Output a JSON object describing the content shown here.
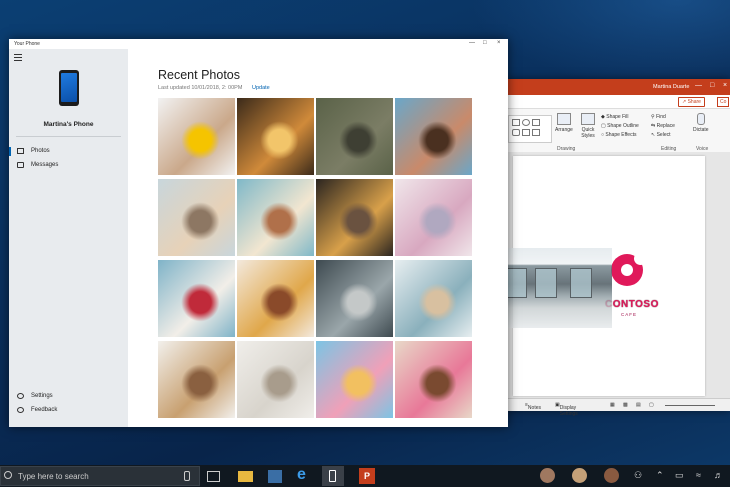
{
  "your_phone": {
    "window_title": "Your Phone",
    "phone_name": "Martina's Phone",
    "nav": [
      {
        "label": "Photos",
        "icon": "photo-icon",
        "selected": true
      },
      {
        "label": "Messages",
        "icon": "message-icon",
        "selected": false
      }
    ],
    "bottom_nav": [
      {
        "label": "Settings",
        "icon": "gear-icon"
      },
      {
        "label": "Feedback",
        "icon": "feedback-icon"
      }
    ],
    "section_title": "Recent Photos",
    "last_updated": "Last updated 10/01/2018, 2: 00PM",
    "update_link": "Update",
    "photos": [
      {
        "subject": "bulldog with yellow ball",
        "colors": [
          "#f2f2f2",
          "#caa88a",
          "#f5c400"
        ]
      },
      {
        "subject": "sunset field",
        "colors": [
          "#3b2a1a",
          "#d08a3a",
          "#f2c56a"
        ]
      },
      {
        "subject": "tree bark moss",
        "colors": [
          "#5a6248",
          "#7b7d65",
          "#3e3f33"
        ]
      },
      {
        "subject": "mother and kids selfie",
        "colors": [
          "#6aa7c9",
          "#c98a6a",
          "#4a3020"
        ]
      },
      {
        "subject": "beach family",
        "colors": [
          "#c8d6dc",
          "#e7d2b8",
          "#8d7763"
        ]
      },
      {
        "subject": "baking table top",
        "colors": [
          "#7fb8c8",
          "#f2e6d0",
          "#b0704a"
        ]
      },
      {
        "subject": "bakery sign",
        "colors": [
          "#2b2520",
          "#d8a04a",
          "#6a5240"
        ]
      },
      {
        "subject": "pink macarons",
        "colors": [
          "#f0e6ea",
          "#d8a8c0",
          "#b0a8c0"
        ]
      },
      {
        "subject": "berry cake",
        "colors": [
          "#7fb3c8",
          "#f2eee8",
          "#c02a3a"
        ]
      },
      {
        "subject": "cupcakes",
        "colors": [
          "#f3e9dd",
          "#e0a74a",
          "#8a4a2a"
        ]
      },
      {
        "subject": "cafe storefront",
        "colors": [
          "#3e4a50",
          "#9aa6aa",
          "#c4c8c8"
        ]
      },
      {
        "subject": "cafe counter",
        "colors": [
          "#e7eef0",
          "#8ab0bc",
          "#d8c0a0"
        ]
      },
      {
        "subject": "baking ingredients",
        "colors": [
          "#f2f0ec",
          "#c8a070",
          "#8a6040"
        ]
      },
      {
        "subject": "bowls and whisk",
        "colors": [
          "#f0eeea",
          "#d8d4cc",
          "#a89c8c"
        ]
      },
      {
        "subject": "donuts on blue",
        "colors": [
          "#7cc4e4",
          "#f0a0b8",
          "#f2c060"
        ]
      },
      {
        "subject": "many donuts",
        "colors": [
          "#e8d8c8",
          "#e87898",
          "#7a4a30"
        ]
      }
    ]
  },
  "powerpoint": {
    "user": "Martina Duarte",
    "share_label": "Share",
    "comments_label": "Co",
    "groups": {
      "drawing": "Drawing",
      "editing": "Editing",
      "voice": "Voice"
    },
    "buttons": {
      "arrange": "Arrange",
      "quick_styles": "Quick Styles",
      "shape_fill": "Shape Fill",
      "shape_outline": "Shape Outline",
      "shape_effects": "Shape Effects",
      "find": "Find",
      "replace": "Replace",
      "select": "Select",
      "dictate": "Dictate"
    },
    "slide_logo_text": "CONTOSO",
    "slide_logo_sub": "CAFE",
    "status": {
      "notes": "Notes",
      "display_settings": "Display Settings"
    }
  },
  "taskbar": {
    "search_placeholder": "Type here to search"
  }
}
